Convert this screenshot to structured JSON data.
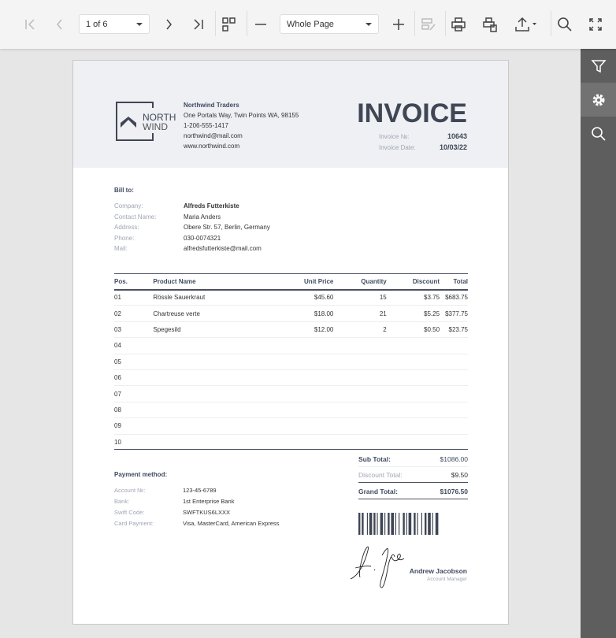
{
  "toolbar": {
    "page_selector": "1 of 6",
    "zoom_selector": "Whole Page"
  },
  "company": {
    "name": "Northwind Traders",
    "address": "One Portals Way, Twin Points WA, 98155",
    "phone": "1-206-555-1417",
    "email": "northwind@mail.com",
    "web": "www.northwind.com",
    "logo_top": "NORTH",
    "logo_bottom": "WIND"
  },
  "invoice": {
    "title": "INVOICE",
    "number_label": "Invoice №:",
    "number": "10643",
    "date_label": "Invoice Date:",
    "date": "10/03/22"
  },
  "bill_to": {
    "heading": "Bill to:",
    "rows": [
      {
        "label": "Company:",
        "value": "Alfreds Futterkiste"
      },
      {
        "label": "Contact Name:",
        "value": "Maria Anders"
      },
      {
        "label": "Address:",
        "value": "Obere Str. 57, Berlin, Germany"
      },
      {
        "label": "Phone:",
        "value": "030-0074321"
      },
      {
        "label": "Mail:",
        "value": "alfredsfutterkiste@mail.com"
      }
    ]
  },
  "table": {
    "headers": [
      "Pos.",
      "Product Name",
      "Unit Price",
      "Quantity",
      "Discount",
      "Total"
    ],
    "rows": [
      [
        "01",
        "Rössle Sauerkraut",
        "$45.60",
        "15",
        "$3.75",
        "$683.75"
      ],
      [
        "02",
        "Chartreuse verte",
        "$18.00",
        "21",
        "$5.25",
        "$377.75"
      ],
      [
        "03",
        "Spegesild",
        "$12.00",
        "2",
        "$0.50",
        "$23.75"
      ],
      [
        "04",
        "",
        "",
        "",
        "",
        ""
      ],
      [
        "05",
        "",
        "",
        "",
        "",
        ""
      ],
      [
        "06",
        "",
        "",
        "",
        "",
        ""
      ],
      [
        "07",
        "",
        "",
        "",
        "",
        ""
      ],
      [
        "08",
        "",
        "",
        "",
        "",
        ""
      ],
      [
        "09",
        "",
        "",
        "",
        "",
        ""
      ],
      [
        "10",
        "",
        "",
        "",
        "",
        ""
      ]
    ]
  },
  "totals": {
    "sub_label": "Sub Total:",
    "sub": "$1086.00",
    "disc_label": "Discount Total:",
    "disc": "$9.50",
    "grand_label": "Grand Total:",
    "grand": "$1076.50"
  },
  "payment": {
    "heading": "Payment method:",
    "rows": [
      {
        "label": "Account №:",
        "value": "123-45-6789"
      },
      {
        "label": "Bank:",
        "value": "1st Enterprise Bank"
      },
      {
        "label": "Swift Code:",
        "value": "SWFTKUS6LXXX"
      },
      {
        "label": "Card Payment:",
        "value": "Visa, MasterCard, American Express"
      }
    ]
  },
  "signature": {
    "name": "Andrew Jacobson",
    "role": "Account Manager"
  }
}
